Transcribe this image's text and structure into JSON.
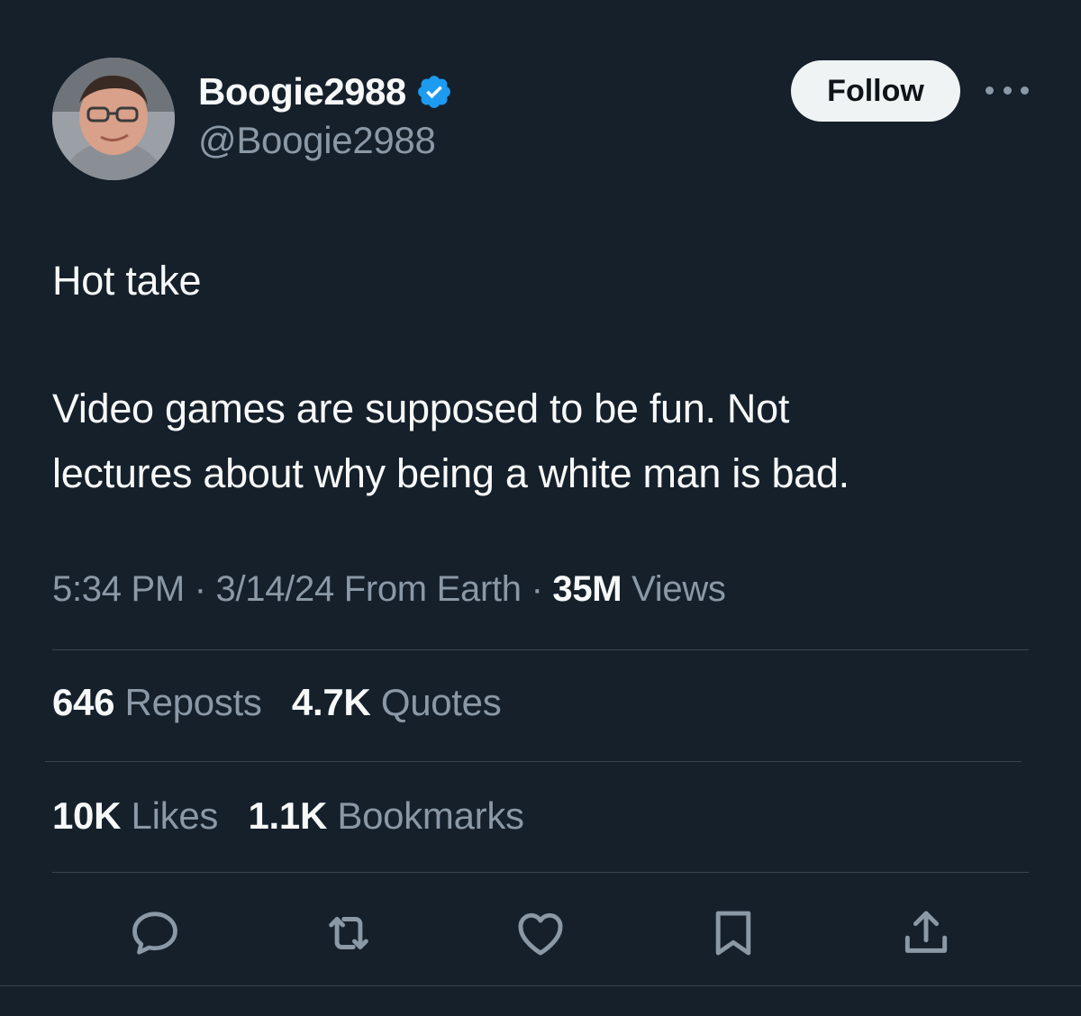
{
  "author": {
    "display_name": "Boogie2988",
    "handle": "@Boogie2988",
    "verified_icon": "verified-badge-icon"
  },
  "follow_label": "Follow",
  "tweet": {
    "line1": "Hot take",
    "line2": "Video games are supposed to be fun. Not",
    "line3": "lectures about why being a white man is bad."
  },
  "meta": {
    "time": "5:34 PM",
    "sep1": " · ",
    "date": "3/14/24",
    "location": " From Earth",
    "sep2": " · ",
    "views_count": "35M",
    "views_label": " Views"
  },
  "stats": {
    "reposts_count": "646",
    "reposts_label": " Reposts",
    "quotes_count": "4.7K",
    "quotes_label": " Quotes",
    "likes_count": "10K",
    "likes_label": " Likes",
    "bookmarks_count": "1.1K",
    "bookmarks_label": " Bookmarks"
  },
  "actions": [
    "reply-icon",
    "repost-icon",
    "like-icon",
    "bookmark-icon",
    "share-icon"
  ],
  "colors": {
    "background": "#15202b",
    "text_primary": "#f7f9f9",
    "text_secondary": "#8b98a5",
    "divider": "#38444d",
    "verified": "#1d9bf0",
    "follow_bg": "#eff3f4"
  }
}
